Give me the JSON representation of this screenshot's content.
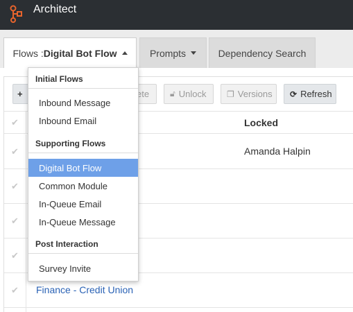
{
  "app": {
    "title": "Architect",
    "brand_color": "#e8642c"
  },
  "tabs": {
    "flows_prefix": "Flows : ",
    "flows_selected": "Digital Bot Flow",
    "prompts": "Prompts",
    "dependency_search": "Dependency Search"
  },
  "toolbar": {
    "add_label": "+",
    "delete_label": "ete",
    "unlock_label": "Unlock",
    "versions_label": "Versions",
    "refresh_label": "Refresh"
  },
  "grid": {
    "locked_header": "Locked",
    "rows": [
      {
        "name": "",
        "locked": "Amanda Halpin"
      },
      {
        "name": "",
        "locked": ""
      },
      {
        "name": "",
        "locked": ""
      },
      {
        "name": "",
        "locked": ""
      },
      {
        "name": "Finance - Credit Union",
        "locked": ""
      }
    ]
  },
  "dropdown": {
    "sections": [
      {
        "header": "Initial Flows",
        "items": [
          "Inbound Message",
          "Inbound Email"
        ]
      },
      {
        "header": "Supporting Flows",
        "items": [
          "Digital Bot Flow",
          "Common Module",
          "In-Queue Email",
          "In-Queue Message"
        ]
      },
      {
        "header": "Post Interaction",
        "items": [
          "Survey Invite"
        ]
      }
    ],
    "selected_item": "Digital Bot Flow",
    "selected_color": "#6ea0e8"
  }
}
